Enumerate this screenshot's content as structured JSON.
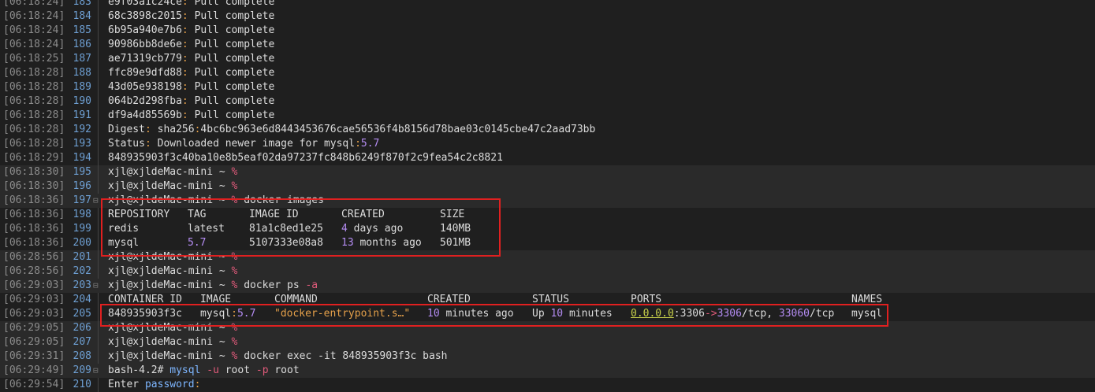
{
  "terminal": {
    "prompt_user": "xjl@xjldeMac-mini ~ ",
    "prompt_symbol": "%",
    "lines": [
      {
        "ts": "[06:18:24]",
        "n": "183",
        "t": "pull",
        "a": "e9f03a1c24ce",
        "b": "Pull complete"
      },
      {
        "ts": "[06:18:24]",
        "n": "184",
        "t": "pull",
        "a": "68c3898c2015",
        "b": "Pull complete"
      },
      {
        "ts": "[06:18:24]",
        "n": "185",
        "t": "pull",
        "a": "6b95a940e7b6",
        "b": "Pull complete"
      },
      {
        "ts": "[06:18:24]",
        "n": "186",
        "t": "pull",
        "a": "90986bb8de6e",
        "b": "Pull complete"
      },
      {
        "ts": "[06:18:25]",
        "n": "187",
        "t": "pull",
        "a": "ae71319cb779",
        "b": "Pull complete"
      },
      {
        "ts": "[06:18:28]",
        "n": "188",
        "t": "pull",
        "a": "ffc89e9dfd88",
        "b": "Pull complete"
      },
      {
        "ts": "[06:18:28]",
        "n": "189",
        "t": "pull",
        "a": "43d05e938198",
        "b": "Pull complete"
      },
      {
        "ts": "[06:18:28]",
        "n": "190",
        "t": "pull",
        "a": "064b2d298fba",
        "b": "Pull complete"
      },
      {
        "ts": "[06:18:28]",
        "n": "191",
        "t": "pull",
        "a": "df9a4d85569b",
        "b": "Pull complete"
      },
      {
        "ts": "[06:18:28]",
        "n": "192",
        "t": "digest",
        "a": "Digest",
        "b": "sha256",
        "c": "4bc6bc963e6d8443453676cae56536f4b8156d78bae03c0145cbe47c2aad73bb"
      },
      {
        "ts": "[06:18:28]",
        "n": "193",
        "t": "status",
        "a": "Status",
        "b": "Downloaded newer image for mysql",
        "c": "5.7"
      },
      {
        "ts": "[06:18:29]",
        "n": "194",
        "t": "plain",
        "a": "848935903f3c40ba10e8b5eaf02da97237fc848b6249f870f2c9fea54c2c8821"
      },
      {
        "ts": "[06:18:30]",
        "n": "195",
        "t": "prompt",
        "a": ""
      },
      {
        "ts": "[06:18:30]",
        "n": "196",
        "t": "prompt",
        "a": ""
      },
      {
        "ts": "[06:18:36]",
        "n": "197",
        "t": "prompt",
        "a": "docker images",
        "fold": true
      },
      {
        "ts": "[06:18:36]",
        "n": "198",
        "t": "img_head"
      },
      {
        "ts": "[06:18:36]",
        "n": "199",
        "t": "img_row",
        "r": 0
      },
      {
        "ts": "[06:18:36]",
        "n": "200",
        "t": "img_row",
        "r": 1
      },
      {
        "ts": "[06:28:56]",
        "n": "201",
        "t": "prompt",
        "a": ""
      },
      {
        "ts": "[06:28:56]",
        "n": "202",
        "t": "prompt",
        "a": ""
      },
      {
        "ts": "[06:29:03]",
        "n": "203",
        "t": "prompt_ps",
        "fold": true
      },
      {
        "ts": "[06:29:03]",
        "n": "204",
        "t": "ps_head"
      },
      {
        "ts": "[06:29:03]",
        "n": "205",
        "t": "ps_row"
      },
      {
        "ts": "[06:29:05]",
        "n": "206",
        "t": "prompt",
        "a": ""
      },
      {
        "ts": "[06:29:05]",
        "n": "207",
        "t": "prompt",
        "a": ""
      },
      {
        "ts": "[06:29:31]",
        "n": "208",
        "t": "prompt",
        "a": "docker exec -it 848935903f3c bash"
      },
      {
        "ts": "[06:29:49]",
        "n": "209",
        "t": "bash",
        "fold": true
      },
      {
        "ts": "[06:29:54]",
        "n": "210",
        "t": "enter"
      }
    ]
  },
  "images_table": {
    "headers": [
      "REPOSITORY",
      "TAG",
      "IMAGE ID",
      "CREATED",
      "SIZE"
    ],
    "rows": [
      {
        "repo": "redis",
        "tag": "latest",
        "id": "81a1c8ed1e25",
        "created_n": "4",
        "created_rest": " days ago",
        "size": "140MB"
      },
      {
        "repo": "mysql",
        "tag": "5.7",
        "id": "5107333e08a8",
        "created_n": "13",
        "created_rest": " months ago",
        "size": "501MB"
      }
    ]
  },
  "ps_table": {
    "command": "docker ps",
    "flag": "-a",
    "headers": [
      "CONTAINER ID",
      "IMAGE",
      "COMMAND",
      "CREATED",
      "STATUS",
      "PORTS",
      "NAMES"
    ],
    "row": {
      "id": "848935903f3c",
      "image_name": "mysql",
      "image_tag": "5.7",
      "command": "\"docker-entrypoint.s…\"",
      "created_n": "10",
      "created_rest": " minutes ago",
      "status_a": "Up ",
      "status_n": "10",
      "status_b": " minutes",
      "ports_ip": "0.0.0.0",
      "ports_host": ":3306",
      "ports_arrow": "->",
      "ports_cont": "3306",
      "ports_rest": "/tcp, ",
      "ports_2": "33060",
      "ports_rest2": "/tcp",
      "name": "mysql"
    }
  },
  "bash_line": {
    "prompt": "bash-4.2# ",
    "cmd": "mysql",
    "f1": "-u",
    "user": " root ",
    "f2": "-p",
    "pw": " root"
  },
  "enter_line": {
    "a": "Enter ",
    "b": "password",
    "c": ":"
  },
  "colors": {
    "background": "#1f1f1f",
    "highlight_box": "#e02020",
    "number": "#b48cf2",
    "timestamp": "#8c8c8c"
  }
}
